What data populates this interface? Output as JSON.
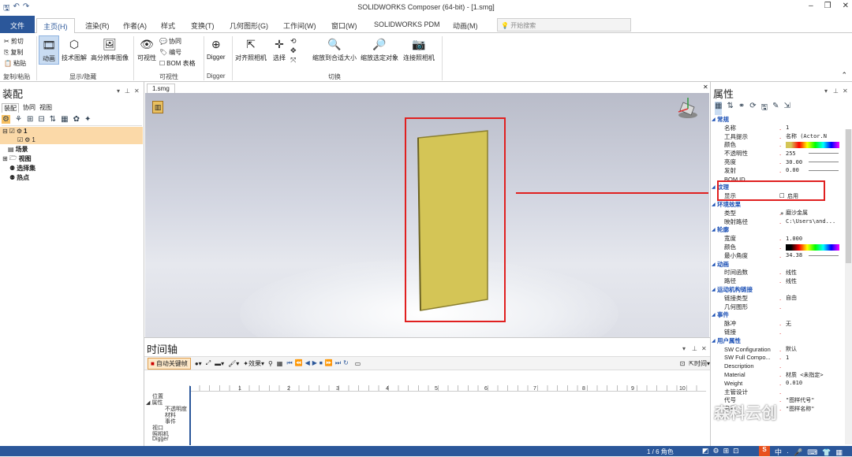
{
  "window": {
    "title": "SOLIDWORKS Composer (64-bit) - [1.smg]",
    "minimize": "–",
    "restore": "❐",
    "close": "✕"
  },
  "menu": {
    "file": "文件",
    "tabs": [
      "主页(H)",
      "渲染(R)",
      "作者(A)",
      "样式",
      "变换(T)",
      "几何图形(G)",
      "工作间(W)",
      "窗口(W)",
      "SOLIDWORKS PDM",
      "动画(M)"
    ],
    "search_placeholder": "开始搜索"
  },
  "ribbon": {
    "cut": "剪切",
    "copy": "复制",
    "paste": "粘贴",
    "clipboard_group": "复制/粘贴",
    "animation": "动画",
    "tech_illustration": "技术图解",
    "hires_image": "高分辨率图像",
    "display_group": "显示/隐藏",
    "visibility": "可视性",
    "collaborate": "协同",
    "number": "编号",
    "bom_table": "BOM 表格",
    "visibility_group": "可视性",
    "digger": "Digger",
    "digger_group": "Digger",
    "align_camera": "对齐照相机",
    "select": "选择",
    "zoom_fit": "缩放到合适大小",
    "zoom_selected": "缩放选定对象",
    "connect_camera": "连接照相机",
    "switch_group": "切换"
  },
  "assembly": {
    "title": "装配",
    "tabs": [
      "装配",
      "协同",
      "视图"
    ],
    "tree": [
      {
        "label": "1",
        "level": 0,
        "selected": true
      },
      {
        "label": "1",
        "level": 1,
        "selected": true
      },
      {
        "label": "场景",
        "level": 0,
        "selected": false
      },
      {
        "label": "视图",
        "level": 0,
        "selected": false
      },
      {
        "label": "选择集",
        "level": 0,
        "selected": false
      },
      {
        "label": "热点",
        "level": 0,
        "selected": false
      }
    ]
  },
  "viewport": {
    "doc_tab": "1.smg",
    "panel_color": "#d4c556"
  },
  "timeline": {
    "title": "时间轴",
    "auto_keyframe": "自动关键帧",
    "effects": "效果",
    "time_label": "时间",
    "ruler_ticks": [
      "1",
      "2",
      "3",
      "4",
      "5",
      "6",
      "7",
      "8",
      "9",
      "10"
    ],
    "tracks": [
      "位置",
      "属性",
      "不透明度",
      "材料",
      "事件",
      "视口",
      "照相机",
      "Digger"
    ]
  },
  "properties": {
    "title": "属性",
    "rows": [
      {
        "type": "section",
        "k": "常规"
      },
      {
        "k": "名称",
        "v": "1"
      },
      {
        "k": "工具提示",
        "v": "名称 (Actor.N"
      },
      {
        "k": "颜色",
        "v": ""
      },
      {
        "k": "不透明性",
        "v": "255"
      },
      {
        "k": "亮度",
        "v": "30.00"
      },
      {
        "k": "发射",
        "v": "0.00"
      },
      {
        "k": "BOM ID",
        "v": ""
      },
      {
        "type": "section",
        "k": "纹理"
      },
      {
        "k": "显示",
        "v": "启用"
      },
      {
        "type": "section",
        "k": "环境效果"
      },
      {
        "k": "类型",
        "v": "磨沙金属"
      },
      {
        "k": "映射路径",
        "v": "C:\\Users\\and..."
      },
      {
        "type": "section",
        "k": "轮廓"
      },
      {
        "k": "宽度",
        "v": "1.000"
      },
      {
        "k": "颜色",
        "v": ""
      },
      {
        "k": "最小角度",
        "v": "34.38"
      },
      {
        "type": "section",
        "k": "动画"
      },
      {
        "k": "时间函数",
        "v": "线性"
      },
      {
        "k": "路径",
        "v": "线性"
      },
      {
        "type": "section",
        "k": "运动机构链接"
      },
      {
        "k": "链接类型",
        "v": "自由"
      },
      {
        "k": "几何图形",
        "v": ""
      },
      {
        "type": "section",
        "k": "事件"
      },
      {
        "k": "脉冲",
        "v": "无"
      },
      {
        "k": "链接",
        "v": ""
      },
      {
        "type": "section",
        "k": "用户属性"
      },
      {
        "k": "SW Configuration",
        "v": "默认"
      },
      {
        "k": "SW Full Compo...",
        "v": "1"
      },
      {
        "k": "Description",
        "v": ""
      },
      {
        "k": "Material",
        "v": "材质 <未指定>"
      },
      {
        "k": "Weight",
        "v": "0.010"
      },
      {
        "k": "主管设计",
        "v": ""
      },
      {
        "k": "代号",
        "v": "\"图样代号\""
      },
      {
        "k": "名称",
        "v": "\"图样名称\""
      }
    ]
  },
  "status": {
    "page": "1 / 6 角色"
  },
  "watermark": "森科云创"
}
